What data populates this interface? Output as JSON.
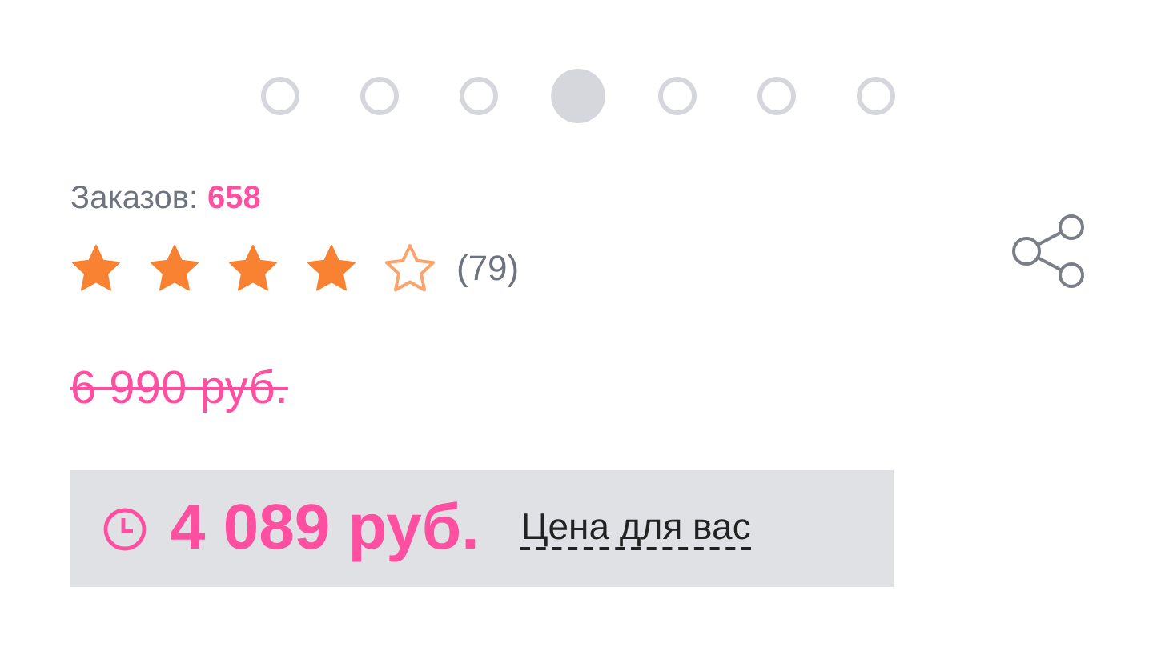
{
  "carousel": {
    "dots": [
      {
        "selected": false
      },
      {
        "selected": false
      },
      {
        "selected": false
      },
      {
        "selected": true
      },
      {
        "selected": false
      },
      {
        "selected": false
      },
      {
        "selected": false
      }
    ]
  },
  "orders": {
    "label": "Заказов:",
    "count": "658"
  },
  "rating": {
    "stars": 4,
    "reviews": "(79)"
  },
  "old_price": "6 990 руб.",
  "price": {
    "value": "4 089 руб.",
    "link": "Цена для вас"
  }
}
